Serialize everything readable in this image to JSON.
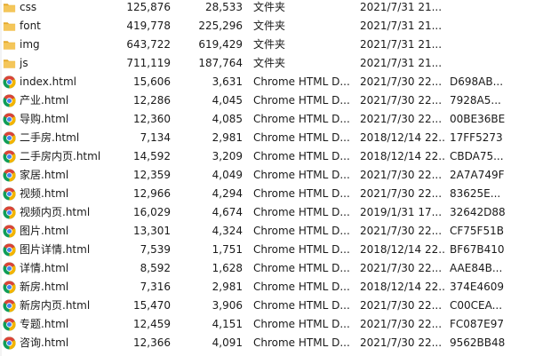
{
  "files": [
    {
      "name": "css",
      "size1": "125,876",
      "size2": "28,533",
      "type": "文件夹",
      "date": "2021/7/31 21...",
      "hash": "",
      "icon": "folder-icon"
    },
    {
      "name": "font",
      "size1": "419,778",
      "size2": "225,296",
      "type": "文件夹",
      "date": "2021/7/31 21...",
      "hash": "",
      "icon": "folder-icon"
    },
    {
      "name": "img",
      "size1": "643,722",
      "size2": "619,429",
      "type": "文件夹",
      "date": "2021/7/31 21...",
      "hash": "",
      "icon": "folder-icon"
    },
    {
      "name": "js",
      "size1": "711,119",
      "size2": "187,764",
      "type": "文件夹",
      "date": "2021/7/31 21...",
      "hash": "",
      "icon": "folder-icon"
    },
    {
      "name": "index.html",
      "size1": "15,606",
      "size2": "3,631",
      "type": "Chrome HTML D...",
      "date": "2021/7/30 22...",
      "hash": "D698AB...",
      "icon": "chrome-icon"
    },
    {
      "name": "产业.html",
      "size1": "12,286",
      "size2": "4,045",
      "type": "Chrome HTML D...",
      "date": "2021/7/30 22...",
      "hash": "7928A5...",
      "icon": "chrome-icon"
    },
    {
      "name": "导购.html",
      "size1": "12,360",
      "size2": "4,085",
      "type": "Chrome HTML D...",
      "date": "2021/7/30 22...",
      "hash": "00BE36BE",
      "icon": "chrome-icon"
    },
    {
      "name": "二手房.html",
      "size1": "7,134",
      "size2": "2,981",
      "type": "Chrome HTML D...",
      "date": "2018/12/14 22...",
      "hash": "17FF5273",
      "icon": "chrome-icon"
    },
    {
      "name": "二手房内页.html",
      "size1": "14,592",
      "size2": "3,209",
      "type": "Chrome HTML D...",
      "date": "2018/12/14 22...",
      "hash": "CBDA75...",
      "icon": "chrome-icon"
    },
    {
      "name": "家居.html",
      "size1": "12,359",
      "size2": "4,049",
      "type": "Chrome HTML D...",
      "date": "2021/7/30 22...",
      "hash": "2A7A749F",
      "icon": "chrome-icon"
    },
    {
      "name": "视频.html",
      "size1": "12,966",
      "size2": "4,294",
      "type": "Chrome HTML D...",
      "date": "2021/7/30 22...",
      "hash": "83625E...",
      "icon": "chrome-icon"
    },
    {
      "name": "视频内页.html",
      "size1": "16,029",
      "size2": "4,674",
      "type": "Chrome HTML D...",
      "date": "2019/1/31 17...",
      "hash": "32642D88",
      "icon": "chrome-icon"
    },
    {
      "name": "图片.html",
      "size1": "13,301",
      "size2": "4,324",
      "type": "Chrome HTML D...",
      "date": "2021/7/30 22...",
      "hash": "CF75F51B",
      "icon": "chrome-icon"
    },
    {
      "name": "图片详情.html",
      "size1": "7,539",
      "size2": "1,751",
      "type": "Chrome HTML D...",
      "date": "2018/12/14 22...",
      "hash": "BF67B410",
      "icon": "chrome-icon"
    },
    {
      "name": "详情.html",
      "size1": "8,592",
      "size2": "1,628",
      "type": "Chrome HTML D...",
      "date": "2021/7/30 22...",
      "hash": "AAE84B...",
      "icon": "chrome-icon"
    },
    {
      "name": "新房.html",
      "size1": "7,316",
      "size2": "2,981",
      "type": "Chrome HTML D...",
      "date": "2018/12/14 22...",
      "hash": "374E4609",
      "icon": "chrome-icon"
    },
    {
      "name": "新房内页.html",
      "size1": "15,470",
      "size2": "3,906",
      "type": "Chrome HTML D...",
      "date": "2021/7/30 22...",
      "hash": "C00CEA...",
      "icon": "chrome-icon"
    },
    {
      "name": "专题.html",
      "size1": "12,459",
      "size2": "4,151",
      "type": "Chrome HTML D...",
      "date": "2021/7/30 22...",
      "hash": "FC087E97",
      "icon": "chrome-icon"
    },
    {
      "name": "咨询.html",
      "size1": "12,366",
      "size2": "4,091",
      "type": "Chrome HTML D...",
      "date": "2021/7/30 22...",
      "hash": "9562BB48",
      "icon": "chrome-icon"
    }
  ],
  "colors": {
    "folder": "#f4c65a",
    "folder_dark": "#e4a92c",
    "chrome_red": "#db4437",
    "chrome_yellow": "#f4b400",
    "chrome_green": "#0f9d58",
    "chrome_blue": "#4285f4"
  }
}
